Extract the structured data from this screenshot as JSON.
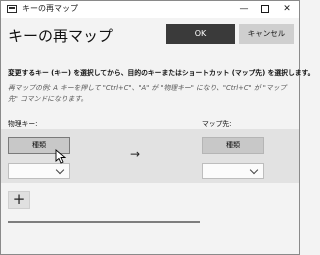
{
  "window": {
    "title": "キーの再マップ",
    "minimize_glyph": "—",
    "close_glyph": "✕"
  },
  "dialog": {
    "heading": "キーの再マップ",
    "ok_label": "OK",
    "cancel_label": "キャンセル",
    "instruction": "変更するキー (キー) を選択してから、目的のキーまたはショートカット (マップ先) を選択します。",
    "example": "再マップの例: A キーを押して \"Ctrl+C\"、\"A\" が \"物理キー\" になり、\"Ctrl+C\" が \"マップ先\" コマンドになります。"
  },
  "mapping": {
    "physical_label": "物理キー:",
    "target_label": "マップ先:",
    "physical_type_button": "種類",
    "target_type_button": "種類",
    "arrow": "→"
  },
  "add_button_glyph": "+",
  "colors": {
    "ok_button_bg": "#3a3a3a",
    "row_bg": "#e2e2e2"
  }
}
